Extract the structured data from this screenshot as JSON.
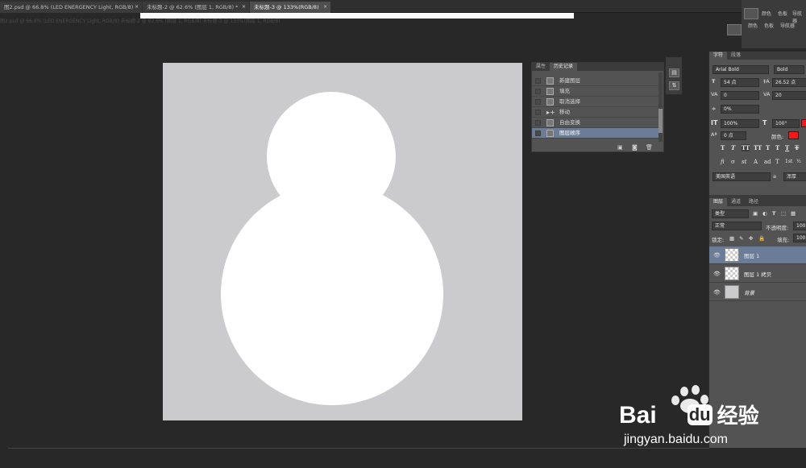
{
  "tabs": [
    {
      "label": "图2.psd @ 66.8% (LED ENERGENCY Light, RGB/8)",
      "close": "×"
    },
    {
      "label": "未标题-2 @ 62.6% (图层 1, RGB/8) *",
      "close": "×"
    },
    {
      "label": "未标题-3 @ 133%(RGB/8)",
      "close": "×"
    }
  ],
  "ghost_row": "图2.psd @ 66.8% (LED ENERGENCY Light, RGB/8)          未标题-2 @ 62.6% (图层 1, RGB/8)          未标题-3 @ 133%(图层 1, RGB/8)",
  "history": {
    "tabs": [
      "属性",
      "历史记录"
    ],
    "items": [
      {
        "label": "新建图层",
        "active": false
      },
      {
        "label": "填充",
        "active": false
      },
      {
        "label": "取消选择",
        "active": false
      },
      {
        "label": "移动",
        "active": false
      },
      {
        "label": "自由变换",
        "active": false
      },
      {
        "label": "图层顺序",
        "active": true
      }
    ]
  },
  "top_right": {
    "tabs1": [
      "颜色",
      "色板",
      "导航器"
    ],
    "tabs2": [
      "颜色",
      "色板",
      "导航器"
    ]
  },
  "character": {
    "tabs": [
      "字符",
      "段落"
    ],
    "font_family": "Arial Bold",
    "font_style": "Bold",
    "font_size": "54 点",
    "leading": "26.52 点",
    "kerning": "0",
    "tracking": "20",
    "scale_pct": "0%",
    "vertical_scale": "100%",
    "horizontal_scale": "100°",
    "baseline_shift": "0 点",
    "color_label": "颜色:",
    "language": "美国英语",
    "aa_label": "a",
    "aa_value": "浑厚",
    "style_buttons": [
      "T",
      "T",
      "TT",
      "TT",
      "T",
      "T",
      "T",
      "T"
    ],
    "ot_buttons": [
      "fi",
      "σ",
      "st",
      "A",
      "ad",
      "T",
      "1st",
      "½"
    ],
    "accent_color": "#ff1515"
  },
  "layers": {
    "tabs": [
      "图层",
      "通道",
      "路径"
    ],
    "filter": "类型",
    "blend_mode": "正常",
    "opacity_label": "不透明度:",
    "opacity_value": "100",
    "lock_label": "锁定:",
    "fill_label": "填充:",
    "fill_value": "100",
    "items": [
      {
        "name": "图层 1",
        "active": true
      },
      {
        "name": "图层 1 拷贝",
        "active": false
      },
      {
        "name": "背景",
        "active": false
      }
    ]
  },
  "watermark": {
    "brand_1": "Bai",
    "brand_2": "du",
    "product": "经验",
    "url": "jingyan.baidu.com"
  },
  "colors": {
    "canvas": "#cbcacd",
    "shape": "#ffffff",
    "selection": "#6b7c98"
  }
}
